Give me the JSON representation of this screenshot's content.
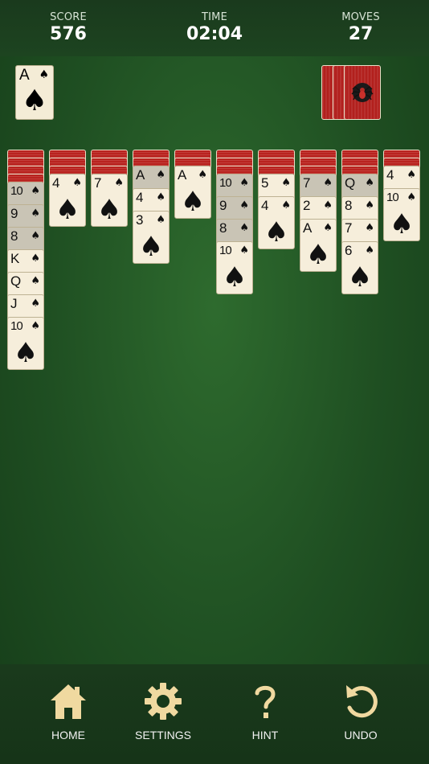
{
  "header": {
    "score_label": "SCORE",
    "score_value": "576",
    "time_label": "TIME",
    "time_value": "02:04",
    "moves_label": "MOVES",
    "moves_value": "27"
  },
  "foundation": {
    "rank": "A",
    "suit": "♠"
  },
  "stock": {
    "piles": 3,
    "back_color": "#b2201d",
    "emblem": "spider-icon"
  },
  "tableau": [
    {
      "facedown": 4,
      "cards": [
        {
          "rank": "10",
          "suit": "♠",
          "dim": true
        },
        {
          "rank": "9",
          "suit": "♠",
          "dim": true
        },
        {
          "rank": "8",
          "suit": "♠",
          "dim": true
        },
        {
          "rank": "K",
          "suit": "♠",
          "dim": false
        },
        {
          "rank": "Q",
          "suit": "♠",
          "dim": false
        },
        {
          "rank": "J",
          "suit": "♠",
          "dim": false
        },
        {
          "rank": "10",
          "suit": "♠",
          "dim": false
        }
      ]
    },
    {
      "facedown": 3,
      "cards": [
        {
          "rank": "4",
          "suit": "♠",
          "dim": false
        }
      ]
    },
    {
      "facedown": 3,
      "cards": [
        {
          "rank": "7",
          "suit": "♠",
          "dim": false
        }
      ]
    },
    {
      "facedown": 2,
      "cards": [
        {
          "rank": "A",
          "suit": "♠",
          "dim": true
        },
        {
          "rank": "4",
          "suit": "♠",
          "dim": false
        },
        {
          "rank": "3",
          "suit": "♠",
          "dim": false
        }
      ]
    },
    {
      "facedown": 2,
      "cards": [
        {
          "rank": "A",
          "suit": "♠",
          "dim": false
        }
      ]
    },
    {
      "facedown": 3,
      "cards": [
        {
          "rank": "10",
          "suit": "♠",
          "dim": true
        },
        {
          "rank": "9",
          "suit": "♠",
          "dim": true
        },
        {
          "rank": "8",
          "suit": "♠",
          "dim": true
        },
        {
          "rank": "10",
          "suit": "♠",
          "dim": false
        }
      ]
    },
    {
      "facedown": 3,
      "cards": [
        {
          "rank": "5",
          "suit": "♠",
          "dim": false
        },
        {
          "rank": "4",
          "suit": "♠",
          "dim": false
        }
      ]
    },
    {
      "facedown": 3,
      "cards": [
        {
          "rank": "7",
          "suit": "♠",
          "dim": true
        },
        {
          "rank": "2",
          "suit": "♠",
          "dim": false
        },
        {
          "rank": "A",
          "suit": "♠",
          "dim": false
        }
      ]
    },
    {
      "facedown": 3,
      "cards": [
        {
          "rank": "Q",
          "suit": "♠",
          "dim": true
        },
        {
          "rank": "8",
          "suit": "♠",
          "dim": false
        },
        {
          "rank": "7",
          "suit": "♠",
          "dim": false
        },
        {
          "rank": "6",
          "suit": "♠",
          "dim": false
        }
      ]
    },
    {
      "facedown": 2,
      "cards": [
        {
          "rank": "4",
          "suit": "♠",
          "dim": false
        },
        {
          "rank": "10",
          "suit": "♠",
          "dim": false
        }
      ]
    }
  ],
  "nav": {
    "home_label": "HOME",
    "settings_label": "SETTINGS",
    "hint_label": "HINT",
    "undo_label": "UNDO",
    "icon_color": "#f0d9a0"
  }
}
